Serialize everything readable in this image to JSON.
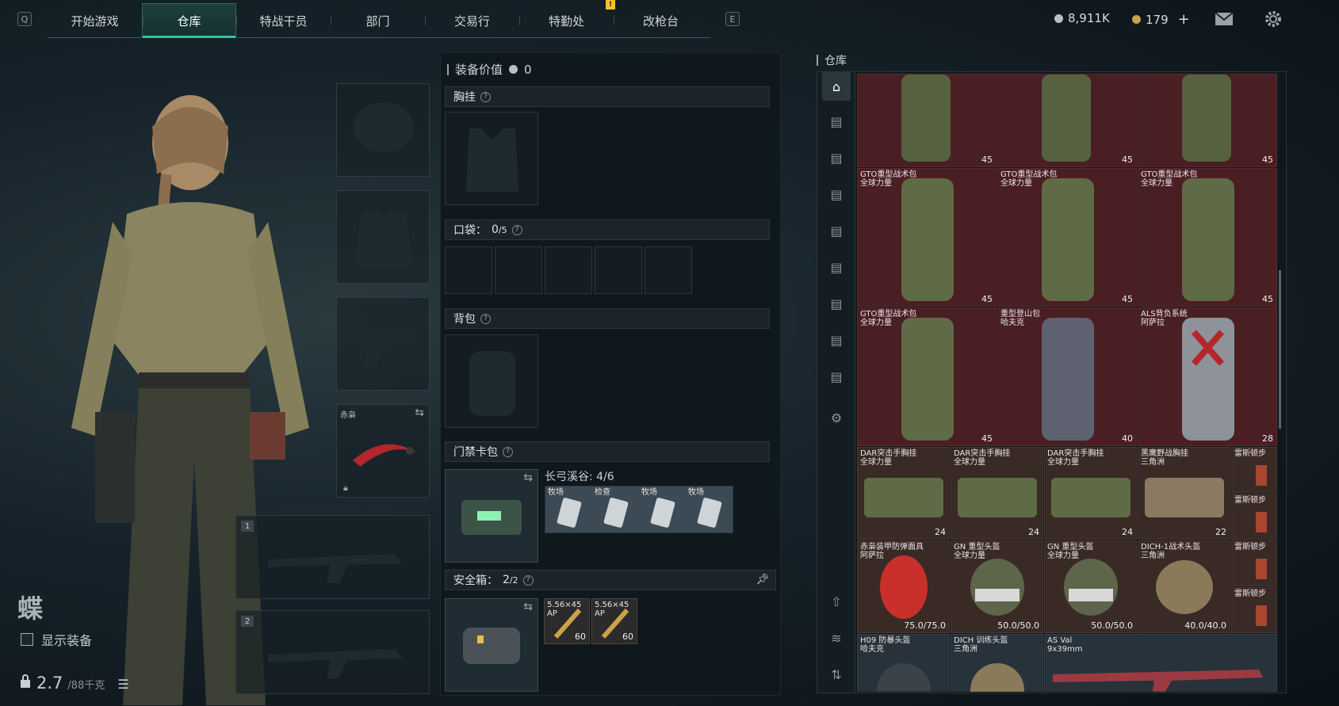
{
  "topbar": {
    "key_left": "Q",
    "key_right": "E",
    "tabs": [
      "开始游戏",
      "仓库",
      "特战干员",
      "部门",
      "交易行",
      "特勤处",
      "改枪台"
    ],
    "active_tab": 1,
    "alert": "!",
    "silver": "8,911K",
    "gold": "179",
    "add": "+"
  },
  "character": {
    "name": "蝶",
    "show_equipment": "显示装备",
    "weight": "2.7",
    "weight_max": "/88千克"
  },
  "slots": {
    "melee_label": "赤枭",
    "weapon1": "1",
    "weapon2": "2"
  },
  "middle": {
    "title": "装备价值",
    "value": "0",
    "chest": "胸挂",
    "pocket": "口袋：",
    "pocket_count": "0",
    "pocket_max": "/5",
    "backpack": "背包",
    "keycard": "门禁卡包",
    "keycard_location": "长弓溪谷: 4/6",
    "keycards": [
      "牧场",
      "检查",
      "牧场",
      "牧场"
    ],
    "safebox": "安全箱：",
    "safebox_count": "2",
    "safebox_max": "/2",
    "ammo": [
      {
        "name": "5.56×45 AP",
        "count": "60"
      },
      {
        "name": "5.56×45 AP",
        "count": "60"
      }
    ]
  },
  "warehouse": {
    "title": "仓库",
    "items": [
      {
        "name": "",
        "count": "45"
      },
      {
        "name": "",
        "count": "45"
      },
      {
        "name": "",
        "count": "45"
      },
      {
        "name": "GTO重型战术包\n全球力量",
        "count": "45"
      },
      {
        "name": "GTO重型战术包\n全球力量",
        "count": "45"
      },
      {
        "name": "GTO重型战术包\n全球力量",
        "count": "45"
      },
      {
        "name": "GTO重型战术包\n全球力量",
        "count": "45"
      },
      {
        "name": "重型登山包\n哈夫克",
        "count": "40"
      },
      {
        "name": "ALS背负系统\n阿萨拉",
        "count": "28"
      },
      {
        "name": "DAR突击手胸挂\n全球力量",
        "count": "24"
      },
      {
        "name": "DAR突击手胸挂\n全球力量",
        "count": "24"
      },
      {
        "name": "DAR突击手胸挂\n全球力量",
        "count": "24"
      },
      {
        "name": "黑鹰野战胸挂\n三角洲",
        "count": "22"
      },
      {
        "name": "赤枭装甲防弹面具\n阿萨拉",
        "count": "75.0/75.0"
      },
      {
        "name": "GN 重型头盔\n全球力量",
        "count": "50.0/50.0"
      },
      {
        "name": "GN 重型头盔\n全球力量",
        "count": "50.0/50.0"
      },
      {
        "name": "DICH-1战术头盔\n三角洲",
        "count": "40.0/40.0"
      },
      {
        "name": "H09 防暴头盔\n哈夫克",
        "count": ""
      },
      {
        "name": "DICH 训练头盔\n三角洲",
        "count": ""
      },
      {
        "name": "AS Val\n9x39mm",
        "count": ""
      }
    ],
    "small_items": [
      "雷斯顿步",
      "雷斯顿步",
      "雷斯顿步",
      "雷斯顿步"
    ]
  }
}
